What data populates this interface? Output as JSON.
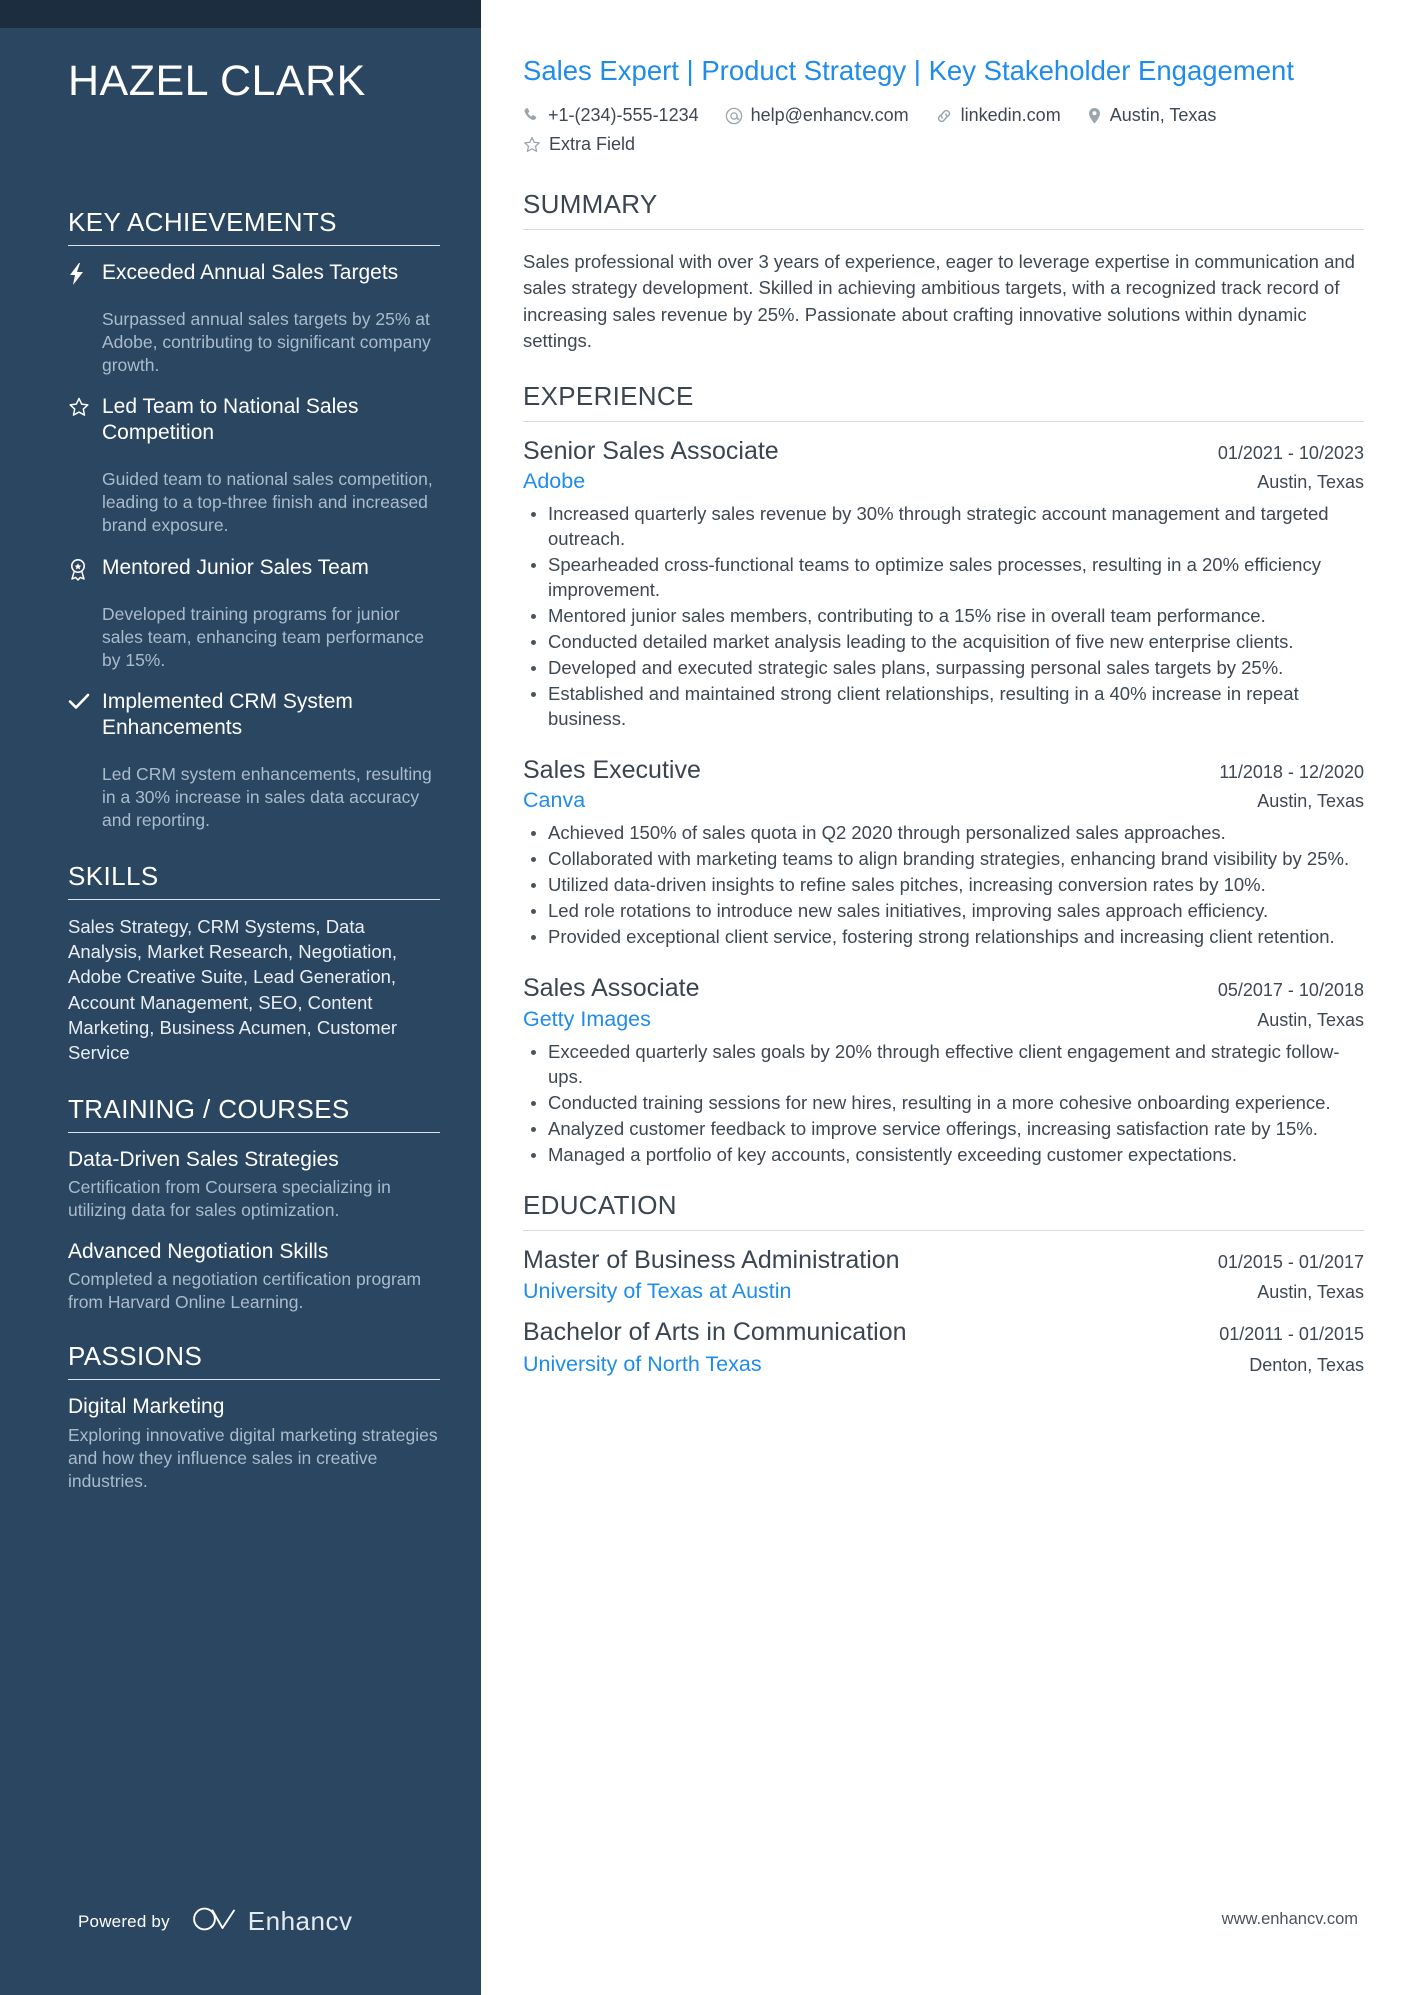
{
  "sidebar": {
    "name": "HAZEL CLARK",
    "achievements": {
      "heading": "KEY ACHIEVEMENTS",
      "items": [
        {
          "icon": "lightning-bolt-icon",
          "title": "Exceeded Annual Sales Targets",
          "description": "Surpassed annual sales targets by 25% at Adobe, contributing to significant company growth."
        },
        {
          "icon": "star-outline-icon",
          "title": "Led Team to National Sales Competition",
          "description": "Guided team to national sales competition, leading to a top-three finish and increased brand exposure."
        },
        {
          "icon": "award-ribbon-icon",
          "title": "Mentored Junior Sales Team",
          "description": "Developed training programs for junior sales team, enhancing team performance by 15%."
        },
        {
          "icon": "checkmark-icon",
          "title": "Implemented CRM System Enhancements",
          "description": "Led CRM system enhancements, resulting in a 30% increase in sales data accuracy and reporting."
        }
      ]
    },
    "skills": {
      "heading": "SKILLS",
      "text": "Sales Strategy, CRM Systems, Data Analysis, Market Research, Negotiation, Adobe Creative Suite, Lead Generation, Account Management, SEO, Content Marketing, Business Acumen, Customer Service"
    },
    "training": {
      "heading": "TRAINING / COURSES",
      "items": [
        {
          "title": "Data-Driven Sales Strategies",
          "description": "Certification from Coursera specializing in utilizing data for sales optimization."
        },
        {
          "title": "Advanced Negotiation Skills",
          "description": "Completed a negotiation certification program from Harvard Online Learning."
        }
      ]
    },
    "passions": {
      "heading": "PASSIONS",
      "items": [
        {
          "title": "Digital Marketing",
          "description": "Exploring innovative digital marketing strategies and how they influence sales in creative industries."
        }
      ]
    },
    "footer": {
      "powered_by": "Powered by",
      "brand": "Enhancv"
    }
  },
  "main": {
    "headline": "Sales Expert | Product Strategy | Key Stakeholder Engagement",
    "contacts": [
      {
        "icon": "phone-icon",
        "text": "+1-(234)-555-1234"
      },
      {
        "icon": "email-at-icon",
        "text": "help@enhancv.com"
      },
      {
        "icon": "link-icon",
        "text": "linkedin.com"
      },
      {
        "icon": "location-pin-icon",
        "text": "Austin, Texas"
      },
      {
        "icon": "star-outline-icon",
        "text": "Extra Field"
      }
    ],
    "summary": {
      "heading": "SUMMARY",
      "text": "Sales professional with over 3 years of experience, eager to leverage expertise in communication and sales strategy development. Skilled in achieving ambitious targets, with a recognized track record of increasing sales revenue by 25%. Passionate about crafting innovative solutions within dynamic settings."
    },
    "experience": {
      "heading": "EXPERIENCE",
      "items": [
        {
          "title": "Senior Sales Associate",
          "date": "01/2021 - 10/2023",
          "company": "Adobe",
          "location": "Austin, Texas",
          "bullets": [
            "Increased quarterly sales revenue by 30% through strategic account management and targeted outreach.",
            "Spearheaded cross-functional teams to optimize sales processes, resulting in a 20% efficiency improvement.",
            "Mentored junior sales members, contributing to a 15% rise in overall team performance.",
            "Conducted detailed market analysis leading to the acquisition of five new enterprise clients.",
            "Developed and executed strategic sales plans, surpassing personal sales targets by 25%.",
            "Established and maintained strong client relationships, resulting in a 40% increase in repeat business."
          ]
        },
        {
          "title": "Sales Executive",
          "date": "11/2018 - 12/2020",
          "company": "Canva",
          "location": "Austin, Texas",
          "bullets": [
            "Achieved 150% of sales quota in Q2 2020 through personalized sales approaches.",
            "Collaborated with marketing teams to align branding strategies, enhancing brand visibility by 25%.",
            "Utilized data-driven insights to refine sales pitches, increasing conversion rates by 10%.",
            "Led role rotations to introduce new sales initiatives, improving sales approach efficiency.",
            "Provided exceptional client service, fostering strong relationships and increasing client retention."
          ]
        },
        {
          "title": "Sales Associate",
          "date": "05/2017 - 10/2018",
          "company": "Getty Images",
          "location": "Austin, Texas",
          "bullets": [
            "Exceeded quarterly sales goals by 20% through effective client engagement and strategic follow-ups.",
            "Conducted training sessions for new hires, resulting in a more cohesive onboarding experience.",
            "Analyzed customer feedback to improve service offerings, increasing satisfaction rate by 15%.",
            "Managed a portfolio of key accounts, consistently exceeding customer expectations."
          ]
        }
      ]
    },
    "education": {
      "heading": "EDUCATION",
      "items": [
        {
          "title": "Master of Business Administration",
          "date": "01/2015 - 01/2017",
          "school": "University of Texas at Austin",
          "location": "Austin, Texas"
        },
        {
          "title": "Bachelor of Arts in Communication",
          "date": "01/2011 - 01/2015",
          "school": "University of North Texas",
          "location": "Denton, Texas"
        }
      ]
    },
    "site_url": "www.enhancv.com"
  },
  "colors": {
    "sidebar_bg": "#2b4661",
    "sidebar_top_strip": "#1c2d3f",
    "accent_blue": "#1f8ceb",
    "body_text": "#3d4852",
    "muted_side_text": "#a9bccd"
  }
}
